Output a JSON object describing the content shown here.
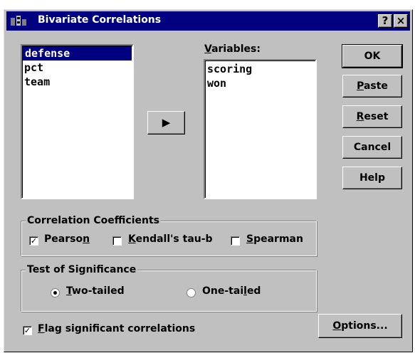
{
  "window": {
    "title": "Bivariate Correlations",
    "help_glyph": "?",
    "close_glyph": "×"
  },
  "source_list": {
    "items": [
      "defense",
      "pct",
      "team"
    ],
    "selected": "defense"
  },
  "variables": {
    "label_pre": "",
    "label_u": "V",
    "label_post": "ariables:",
    "items": [
      "scoring",
      "won"
    ]
  },
  "move_button": {
    "glyph": "▶"
  },
  "buttons": {
    "ok": "OK",
    "paste_u": "P",
    "paste_rest": "aste",
    "reset_u": "R",
    "reset_rest": "eset",
    "cancel": "Cancel",
    "help": "Help",
    "options_u": "O",
    "options_rest": "ptions..."
  },
  "correlation": {
    "title": "Correlation Coefficients",
    "pearson_pre": "Pearso",
    "pearson_u": "n",
    "pearson_checked": true,
    "kendall_u": "K",
    "kendall_rest": "endall's tau-b",
    "kendall_checked": false,
    "spearman_u": "S",
    "spearman_rest": "pearman",
    "spearman_checked": false
  },
  "significance": {
    "title": "Test of Significance",
    "two_u": "T",
    "two_rest": "wo-tailed",
    "two_selected": true,
    "one_pre": "One-tai",
    "one_u": "l",
    "one_post": "ed",
    "one_selected": false
  },
  "flag": {
    "u": "F",
    "rest": "lag significant correlations",
    "checked": true
  },
  "check_mark": "✓"
}
